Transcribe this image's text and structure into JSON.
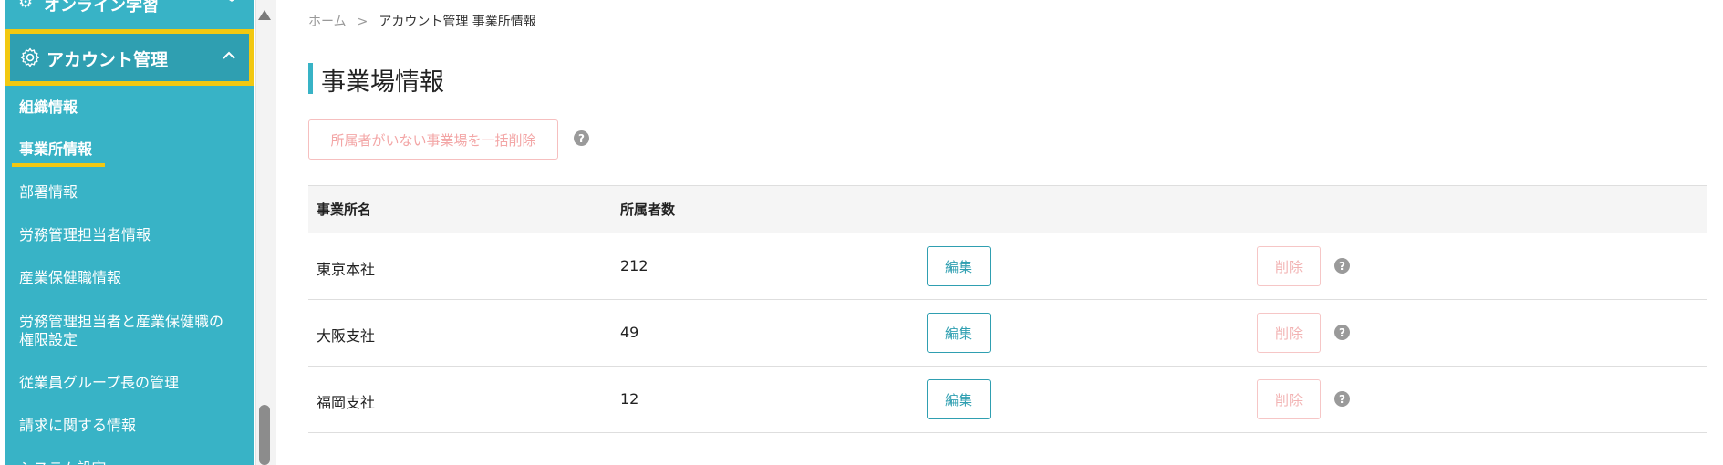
{
  "sidebar": {
    "prev_item": {
      "label": "オンライン学習"
    },
    "account_header": {
      "label": "アカウント管理"
    },
    "items": [
      {
        "label": "組織情報"
      },
      {
        "label": "事業所情報"
      },
      {
        "label": "部署情報"
      },
      {
        "label": "労務管理担当者情報"
      },
      {
        "label": "産業保健職情報"
      },
      {
        "label": "労務管理担当者と産業保健職の"
      },
      {
        "label": "権限設定"
      },
      {
        "label": "従業員グループ長の管理"
      },
      {
        "label": "請求に関する情報"
      },
      {
        "label": "システム設定"
      }
    ]
  },
  "breadcrumb": {
    "home": "ホーム",
    "separator": ">",
    "current": "アカウント管理 事業所情報"
  },
  "page": {
    "title": "事業場情報",
    "bulk_delete_label": "所属者がいない事業場を一括削除",
    "help_glyph": "?"
  },
  "table": {
    "headers": {
      "name": "事業所名",
      "members": "所属者数"
    },
    "rows": [
      {
        "name": "東京本社",
        "members": "212",
        "edit": "編集",
        "delete": "削除"
      },
      {
        "name": "大阪支社",
        "members": "49",
        "edit": "編集",
        "delete": "削除"
      },
      {
        "name": "福岡支社",
        "members": "12",
        "edit": "編集",
        "delete": "削除"
      }
    ]
  },
  "colors": {
    "sidebar": "#38b3c6",
    "highlight": "#f2c811",
    "accent": "#2f9fb1",
    "danger_light": "#f3a6a6"
  }
}
